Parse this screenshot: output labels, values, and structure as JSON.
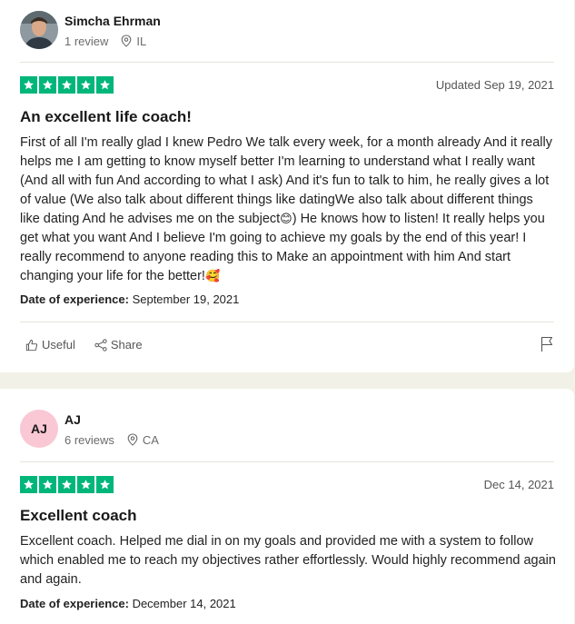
{
  "reviews": [
    {
      "consumer": {
        "name": "Simcha Ehrman",
        "review_count": "1 review",
        "location": "IL",
        "avatar": "photo"
      },
      "rating": 5,
      "date": "Updated Sep 19, 2021",
      "title": "An excellent life coach!",
      "body_part1": "First of all I'm really glad I knew Pedro We talk every week, for a month already And it really helps me I am getting to know myself better I'm learning to understand what I really want (And all with fun And according to what I ask) And it's fun to talk to him, he really gives a lot of value (We also talk about different things like datingWe also talk about different things like dating And he advises me on the subject",
      "emoji1": "😊",
      "body_part2": ") He knows how to listen! It really helps you get what you want And I believe I'm going to achieve my goals by the end of this year! I really recommend to anyone reading this to Make an appointment with him And start changing your life for the better!",
      "emoji2": "🥰",
      "experience_label": "Date of experience:",
      "experience_date": "September 19, 2021",
      "useful_label": "Useful",
      "share_label": "Share"
    },
    {
      "consumer": {
        "name": "AJ",
        "initials": "AJ",
        "review_count": "6 reviews",
        "location": "CA"
      },
      "rating": 5,
      "date": "Dec 14, 2021",
      "title": "Excellent coach",
      "body": "Excellent coach. Helped me dial in on my goals and provided me with a system to follow which enabled me to reach my objectives rather effortlessly. Would highly recommend again and again.",
      "experience_label": "Date of experience:",
      "experience_date": "December 14, 2021"
    }
  ],
  "colors": {
    "star_green": "#00b67a",
    "initials_bg": "#f9c8d4",
    "page_bg": "#f1f1e8"
  },
  "icons": {
    "location": "location-pin-icon",
    "useful": "thumbs-up-icon",
    "share": "share-icon",
    "report": "flag-icon",
    "star": "star-icon"
  }
}
